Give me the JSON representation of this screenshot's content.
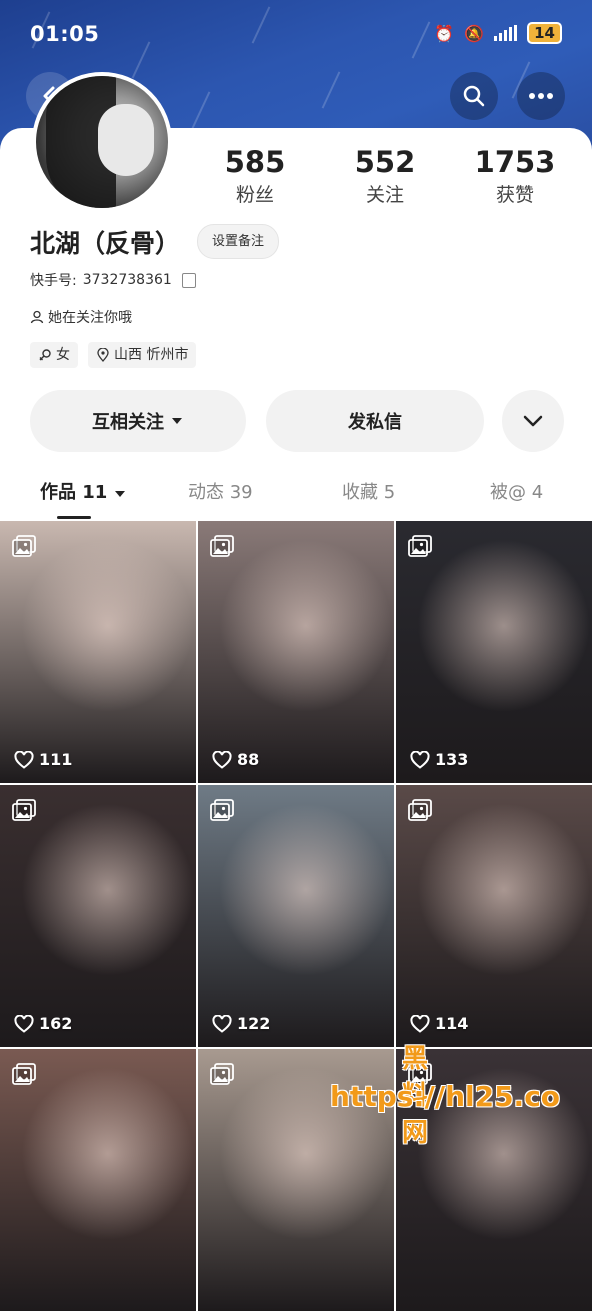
{
  "status_bar": {
    "time": "01:05",
    "signal": "4G",
    "battery": "14"
  },
  "profile": {
    "stats": [
      {
        "value": "585",
        "label": "粉丝"
      },
      {
        "value": "552",
        "label": "关注"
      },
      {
        "value": "1753",
        "label": "获赞"
      }
    ],
    "name": "北湖（反骨）",
    "note_button": "设置备注",
    "user_id_label": "快手号:",
    "user_id": "3732738361",
    "follow_status": "她在关注你哦",
    "gender": "女",
    "location": "山西 忻州市"
  },
  "actions": {
    "follow": "互相关注",
    "message": "发私信"
  },
  "tabs": [
    {
      "label": "作品 11",
      "active": true
    },
    {
      "label": "动态 39",
      "active": false
    },
    {
      "label": "收藏 5",
      "active": false
    },
    {
      "label": "被@ 4",
      "active": false
    }
  ],
  "posts": [
    {
      "likes": "111",
      "color": "#c9b8b0"
    },
    {
      "likes": "88",
      "color": "#8a7a78"
    },
    {
      "likes": "133",
      "color": "#2a2a30"
    },
    {
      "likes": "162",
      "color": "#3a2f30"
    },
    {
      "likes": "122",
      "color": "#6f7b86"
    },
    {
      "likes": "114",
      "color": "#5a4a48"
    },
    {
      "likes": "",
      "color": "#7a5a52"
    },
    {
      "likes": "",
      "color": "#a89a90"
    },
    {
      "likes": "",
      "color": "#3a3236"
    }
  ],
  "watermark": {
    "line1": "黑料网",
    "line2": "https://hl25.co"
  }
}
